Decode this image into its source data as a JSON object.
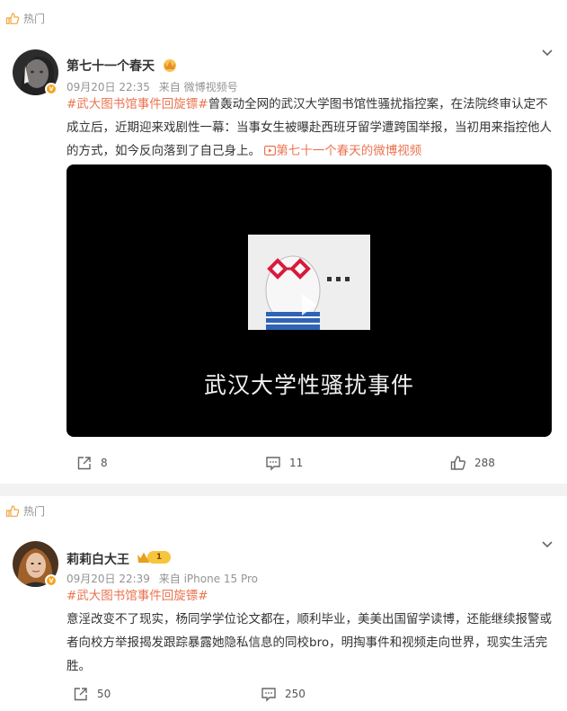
{
  "posts": [
    {
      "hot_label": "热门",
      "username": "第七十一个春天",
      "date": "09月20日 22:35",
      "source": "来自 微博视频号",
      "hashtag": "#武大图书馆事件回旋镖#",
      "body": "曾轰动全网的武汉大学图书馆性骚扰指控案，在法院终审认定不成立后，近期迎来戏剧性一幕：当事女生被曝赴西班牙留学遭跨国举报，当初用来指控他人的方式，如今反向落到了自己身上。",
      "video_link": "第七十一个春天的微博视频",
      "video_caption": "武汉大学性骚扰事件",
      "repost_count": "8",
      "comment_count": "11",
      "like_count": "288"
    },
    {
      "hot_label": "热门",
      "username": "莉莉白大王",
      "vip_level": "1",
      "date": "09月20日 22:39",
      "source": "来自 iPhone 15 Pro",
      "hashtag": "#武大图书馆事件回旋镖#",
      "body": "意淫改变不了现实，杨同学学位论文都在，顺利毕业，美美出国留学读博，还能继续报警或者向校方举报揭发跟踪暴露她隐私信息的同校bro，明掏事件和视频走向世界，现实生活完胜。",
      "repost_count": "50",
      "comment_count": "250"
    }
  ],
  "icons": {
    "hot": "thumbs-up-outline-icon",
    "more": "chevron-down-icon",
    "repost": "share-icon",
    "comment": "comment-icon",
    "like": "thumbs-up-icon",
    "verified": "verified-badge-icon"
  },
  "colors": {
    "accent": "#eb7350",
    "meta_text": "#939393",
    "badge": "#f5a623",
    "video_bg": "#000000"
  }
}
